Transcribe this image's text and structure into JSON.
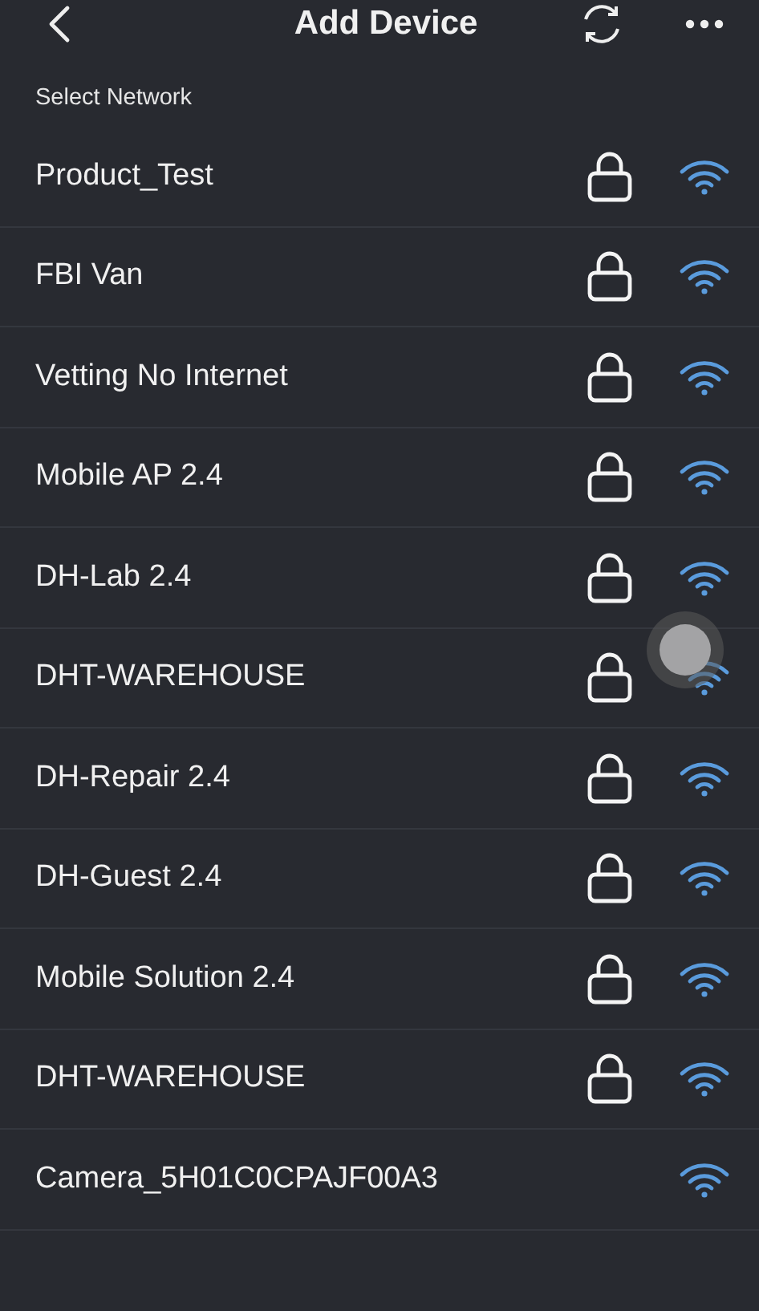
{
  "header": {
    "title": "Add Device"
  },
  "section_label": "Select Network",
  "networks": [
    {
      "name": "Product_Test",
      "locked": true
    },
    {
      "name": "FBI Van",
      "locked": true
    },
    {
      "name": "Vetting No Internet",
      "locked": true
    },
    {
      "name": "Mobile AP 2.4",
      "locked": true
    },
    {
      "name": "DH-Lab 2.4",
      "locked": true
    },
    {
      "name": "DHT-WAREHOUSE",
      "locked": true
    },
    {
      "name": "DH-Repair 2.4",
      "locked": true
    },
    {
      "name": "DH-Guest 2.4",
      "locked": true
    },
    {
      "name": "Mobile Solution 2.4",
      "locked": true
    },
    {
      "name": "DHT-WAREHOUSE",
      "locked": true
    },
    {
      "name": "Camera_5H01C0CPAJF00A3",
      "locked": false
    }
  ]
}
